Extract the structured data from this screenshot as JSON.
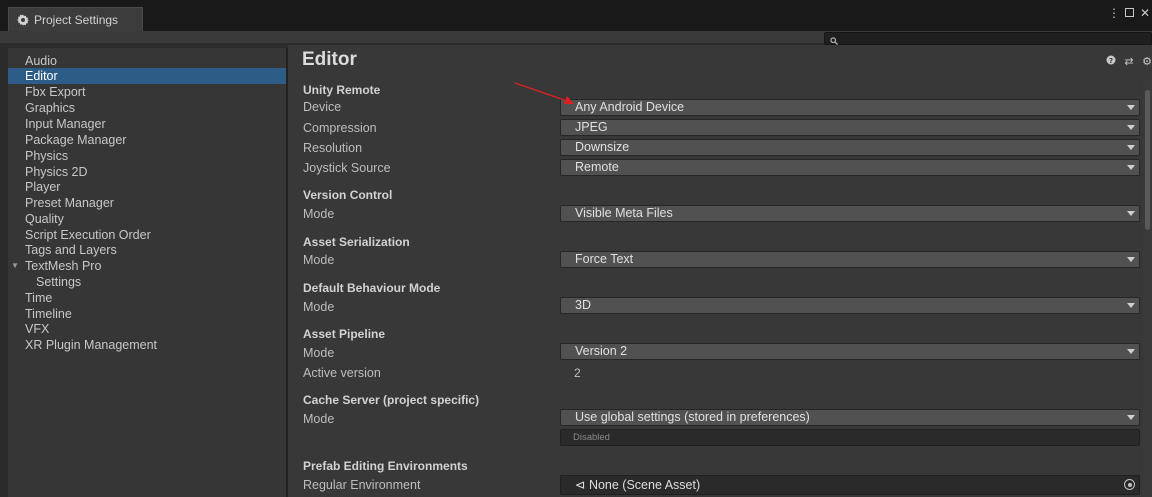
{
  "window": {
    "tab_title": "Project Settings",
    "tab_icon": "gear-icon",
    "controls": [
      "more-icon",
      "maximize-icon",
      "close-icon"
    ]
  },
  "search": {
    "placeholder": "",
    "icon": "search-icon"
  },
  "sidebar": {
    "items": [
      {
        "label": "Audio"
      },
      {
        "label": "Editor",
        "selected": true
      },
      {
        "label": "Fbx Export"
      },
      {
        "label": "Graphics"
      },
      {
        "label": "Input Manager"
      },
      {
        "label": "Package Manager"
      },
      {
        "label": "Physics"
      },
      {
        "label": "Physics 2D"
      },
      {
        "label": "Player"
      },
      {
        "label": "Preset Manager"
      },
      {
        "label": "Quality"
      },
      {
        "label": "Script Execution Order"
      },
      {
        "label": "Tags and Layers"
      },
      {
        "label": "TextMesh Pro",
        "expanded": true
      },
      {
        "label": "Settings",
        "child": true
      },
      {
        "label": "Time"
      },
      {
        "label": "Timeline"
      },
      {
        "label": "VFX"
      },
      {
        "label": "XR Plugin Management"
      }
    ]
  },
  "main": {
    "title": "Editor",
    "header_icons": [
      "help-icon",
      "preset-icon",
      "settings-icon"
    ],
    "unity_remote": {
      "header": "Unity Remote",
      "device_label": "Device",
      "device_value": "Any Android Device",
      "compression_label": "Compression",
      "compression_value": "JPEG",
      "resolution_label": "Resolution",
      "resolution_value": "Downsize",
      "joystick_label": "Joystick Source",
      "joystick_value": "Remote"
    },
    "version_control": {
      "header": "Version Control",
      "mode_label": "Mode",
      "mode_value": "Visible Meta Files"
    },
    "asset_serialization": {
      "header": "Asset Serialization",
      "mode_label": "Mode",
      "mode_value": "Force Text"
    },
    "default_behaviour": {
      "header": "Default Behaviour Mode",
      "mode_label": "Mode",
      "mode_value": "3D"
    },
    "asset_pipeline": {
      "header": "Asset Pipeline",
      "mode_label": "Mode",
      "mode_value": "Version 2",
      "active_label": "Active version",
      "active_value": "2"
    },
    "cache_server": {
      "header": "Cache Server (project specific)",
      "mode_label": "Mode",
      "mode_value": "Use global settings (stored in preferences)",
      "status_value": "Disabled"
    },
    "prefab_editing": {
      "header": "Prefab Editing Environments",
      "regular_label": "Regular Environment",
      "regular_value": "None (Scene Asset)"
    }
  },
  "colors": {
    "selected_bg": "#2c5d87",
    "annotation_arrow": "#e02020",
    "panel_bg": "#383838",
    "sidebar_bg": "#363636"
  }
}
